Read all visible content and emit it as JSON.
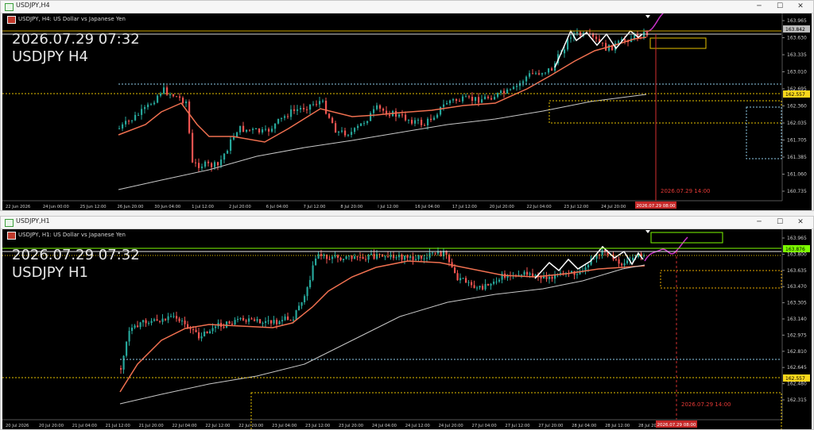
{
  "top": {
    "window_title": "USDJPY,H4",
    "header": "USDJPY, H4:  US Dollar vs Japanese Yen",
    "date_label": "2026.07.29 07:32",
    "symbol_label": "USDJPY H4",
    "price_ticks": [
      "163.965",
      "163.630",
      "163.335",
      "163.010",
      "162.695",
      "162.360",
      "162.035",
      "161.705",
      "161.385",
      "161.060",
      "160.735"
    ],
    "tag_gray": "163.842",
    "tag_yellow": "162.557",
    "time_ticks": [
      "22 Jun 2026",
      "24 Jun 00:00",
      "25 Jun 12:00",
      "26 Jun 20:00",
      "30 Jun 04:00",
      "1 Jul 12:00",
      "2 Jul 20:00",
      "6 Jul 04:00",
      "7 Jul 12:00",
      "8 Jul 20:00",
      "l Jul 12:00",
      "16 Jul 04:00",
      "17 Jul 12:00",
      "20 Jul 20:00",
      "22 Jul 04:00",
      "23 Jul 12:00",
      "24 Jul 20:00",
      "28 Jul 04:00"
    ],
    "red_time_tag": "2026.07.29 08:00",
    "forecast_label": "2026.07.29 14:00"
  },
  "bottom": {
    "window_title": "USDJPY,H1",
    "header": "USDJPY, H1:  US Dollar vs Japanese Yen",
    "date_label": "2026.07.29 07:32",
    "symbol_label": "USDJPY H1",
    "price_ticks": [
      "163.965",
      "163.800",
      "163.635",
      "163.470",
      "163.305",
      "163.140",
      "162.975",
      "162.810",
      "162.645",
      "162.480",
      "162.315"
    ],
    "tag_green": "163.876",
    "tag_yellow": "162.557",
    "time_ticks": [
      "20 Jul 2026",
      "20 Jul 20:00",
      "21 Jul 04:00",
      "21 Jul 12:00",
      "21 Jul 20:00",
      "22 Jul 04:00",
      "22 Jul 12:00",
      "22 Jul 20:00",
      "23 Jul 04:00",
      "23 Jul 12:00",
      "23 Jul 20:00",
      "24 Jul 04:00",
      "24 Jul 12:00",
      "24 Jul 20:00",
      "27 Jul 04:00",
      "27 Jul 12:00",
      "27 Jul 20:00",
      "28 Jul 04:00",
      "28 Jul 12:00",
      "28 Jul 20:00"
    ],
    "red_time_tag": "2026.07.29 08:00",
    "forecast_label": "2026.07.29 14:00"
  },
  "icons": {
    "minimize": "minimize-icon",
    "maximize": "maximize-icon",
    "close": "close-icon"
  },
  "colors": {
    "bull": "#26a69a",
    "bear": "#ef5350",
    "ma_fast": "#f07050",
    "ma_slow": "#c8c8c8",
    "zigzag": "#ffffff",
    "forecast": "#cc33cc",
    "level": "#ffd54f",
    "tag_green": "#7cfc00",
    "grid": "#1a1a1a"
  }
}
